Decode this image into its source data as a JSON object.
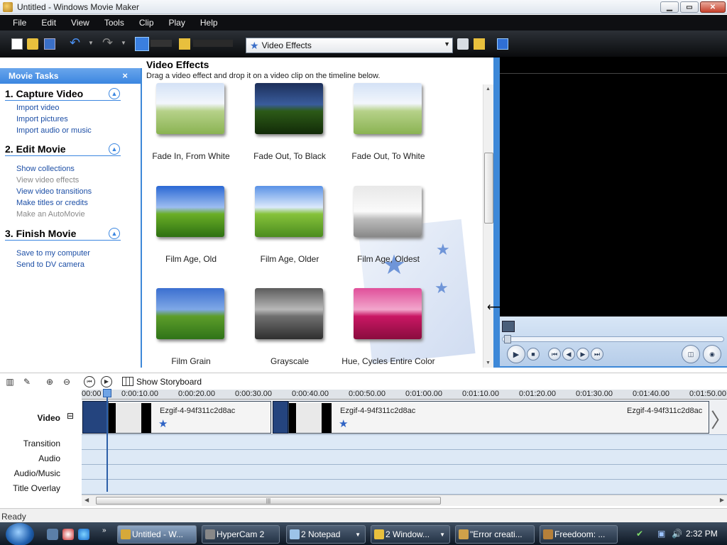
{
  "window": {
    "title": "Untitled - Windows Movie Maker",
    "controls": {
      "minimize": "▁",
      "maximize": "▭",
      "close": "✕"
    }
  },
  "menu": [
    "File",
    "Edit",
    "View",
    "Tools",
    "Clip",
    "Play",
    "Help"
  ],
  "toolbar": {
    "effects_dropdown": "Video Effects",
    "icons": [
      "new-project-icon",
      "open-project-icon",
      "save-project-icon",
      "undo-icon",
      "redo-icon",
      "tasks-icon",
      "collections-icon",
      "up-folder-icon",
      "new-folder-icon",
      "view-options-icon"
    ]
  },
  "tasks": {
    "header": "Movie Tasks",
    "close": "×",
    "sections": [
      {
        "title": "1. Capture Video",
        "items": [
          {
            "label": "Import video",
            "enabled": true
          },
          {
            "label": "Import pictures",
            "enabled": true
          },
          {
            "label": "Import audio or music",
            "enabled": true
          }
        ]
      },
      {
        "title": "2. Edit Movie",
        "items": [
          {
            "label": "Show collections",
            "enabled": true
          },
          {
            "label": "View video effects",
            "enabled": false
          },
          {
            "label": "View video transitions",
            "enabled": true
          },
          {
            "label": "Make titles or credits",
            "enabled": true
          },
          {
            "label": "Make an AutoMovie",
            "enabled": false
          }
        ]
      },
      {
        "title": "3. Finish Movie",
        "items": [
          {
            "label": "Save to my computer",
            "enabled": true
          },
          {
            "label": "Send to DV camera",
            "enabled": true
          }
        ]
      }
    ]
  },
  "effects": {
    "title": "Video Effects",
    "subtitle": "Drag a video effect and drop it on a video clip on the timeline below.",
    "items": [
      {
        "label": "Fade In, From White",
        "style": "white"
      },
      {
        "label": "Fade Out, To Black",
        "style": "black"
      },
      {
        "label": "Fade Out, To White",
        "style": "white"
      },
      {
        "label": "Film Age, Old",
        "style": "old"
      },
      {
        "label": "Film Age, Older",
        "style": "older"
      },
      {
        "label": "Film Age, Oldest",
        "style": "oldest"
      },
      {
        "label": "Film Grain",
        "style": "grain"
      },
      {
        "label": "Grayscale",
        "style": "gray"
      },
      {
        "label": "Hue, Cycles Entire Color Spectrum",
        "style": "pink"
      }
    ]
  },
  "timeline": {
    "show_storyboard": "Show Storyboard",
    "ruler_ticks": [
      "00:00",
      "0:00:10.00",
      "0:00:20.00",
      "0:00:30.00",
      "0:00:40.00",
      "0:00:50.00",
      "0:01:00.00",
      "0:01:10.00",
      "0:01:20.00",
      "0:01:30.00",
      "0:01:40.00",
      "0:01:50.00"
    ],
    "tracks": [
      "Video",
      "Transition",
      "Audio",
      "Audio/Music",
      "Title Overlay"
    ],
    "collapse_toggle": "⊟",
    "clips": [
      {
        "name": "Ezgif-4-94f311c2d8ac"
      },
      {
        "name": "Ezgif-4-94f311c2d8ac"
      },
      {
        "name": "Ezgif-4-94f311c2d8ac"
      }
    ]
  },
  "status": "Ready",
  "taskbar": {
    "tasks": [
      {
        "label": "Untitled - W...",
        "active": true
      },
      {
        "label": "HyperCam 2",
        "active": false
      },
      {
        "label": "2 Notepad",
        "active": false
      },
      {
        "label": "2 Window...",
        "active": false
      },
      {
        "label": "\"Error creati...",
        "active": false
      },
      {
        "label": "Freedoom: ...",
        "active": false
      }
    ],
    "clock": "2:32 PM"
  }
}
